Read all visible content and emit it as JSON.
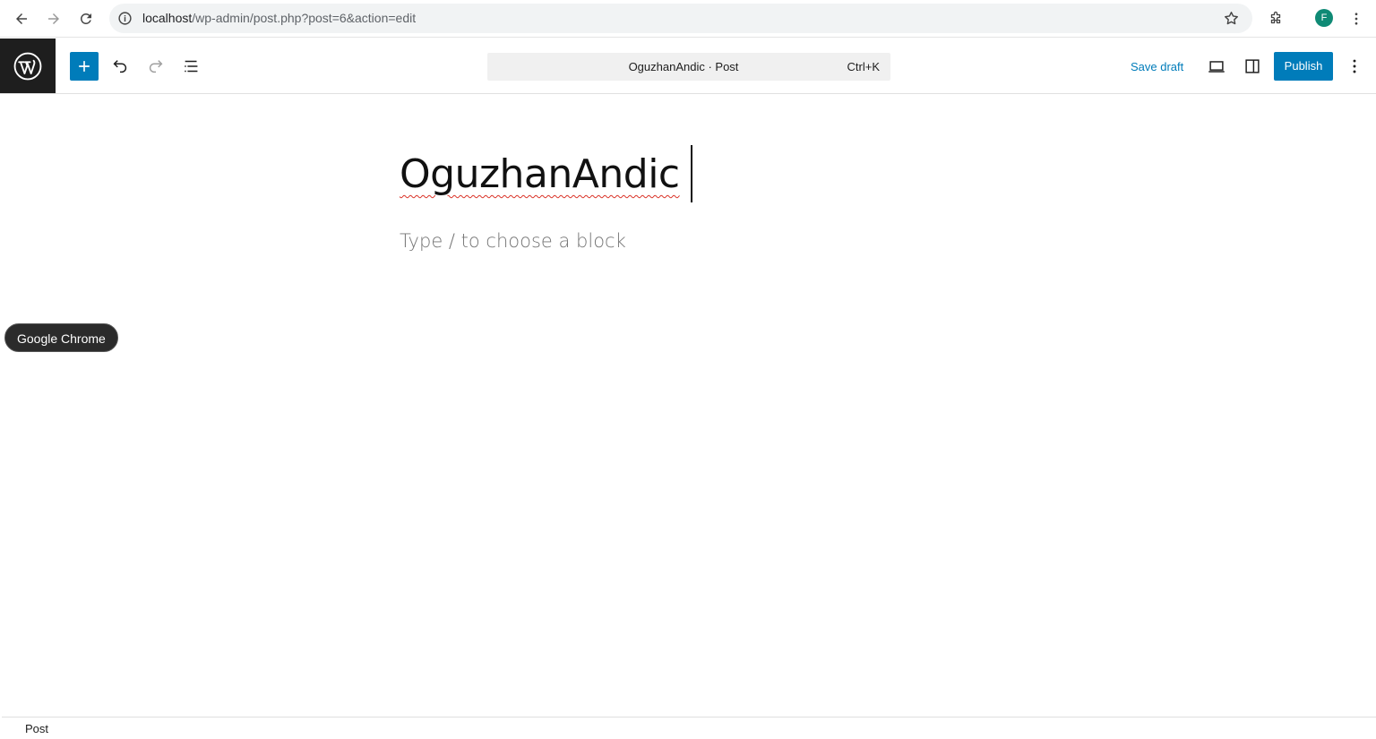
{
  "browser": {
    "url_host": "localhost",
    "url_path": "/wp-admin/post.php?post=6&action=edit",
    "profile_initial": "F",
    "profile_color": "#0f8a75"
  },
  "editor_header": {
    "command_bar_title": "OguzhanAndic · Post",
    "command_bar_shortcut": "Ctrl+K",
    "save_draft_label": "Save draft",
    "publish_label": "Publish",
    "accent_color": "#007cba"
  },
  "canvas": {
    "post_title": "OguzhanAndic",
    "block_placeholder": "Type / to choose a block"
  },
  "tooltip": {
    "text": "Google Chrome"
  },
  "footer": {
    "breadcrumb": "Post"
  }
}
